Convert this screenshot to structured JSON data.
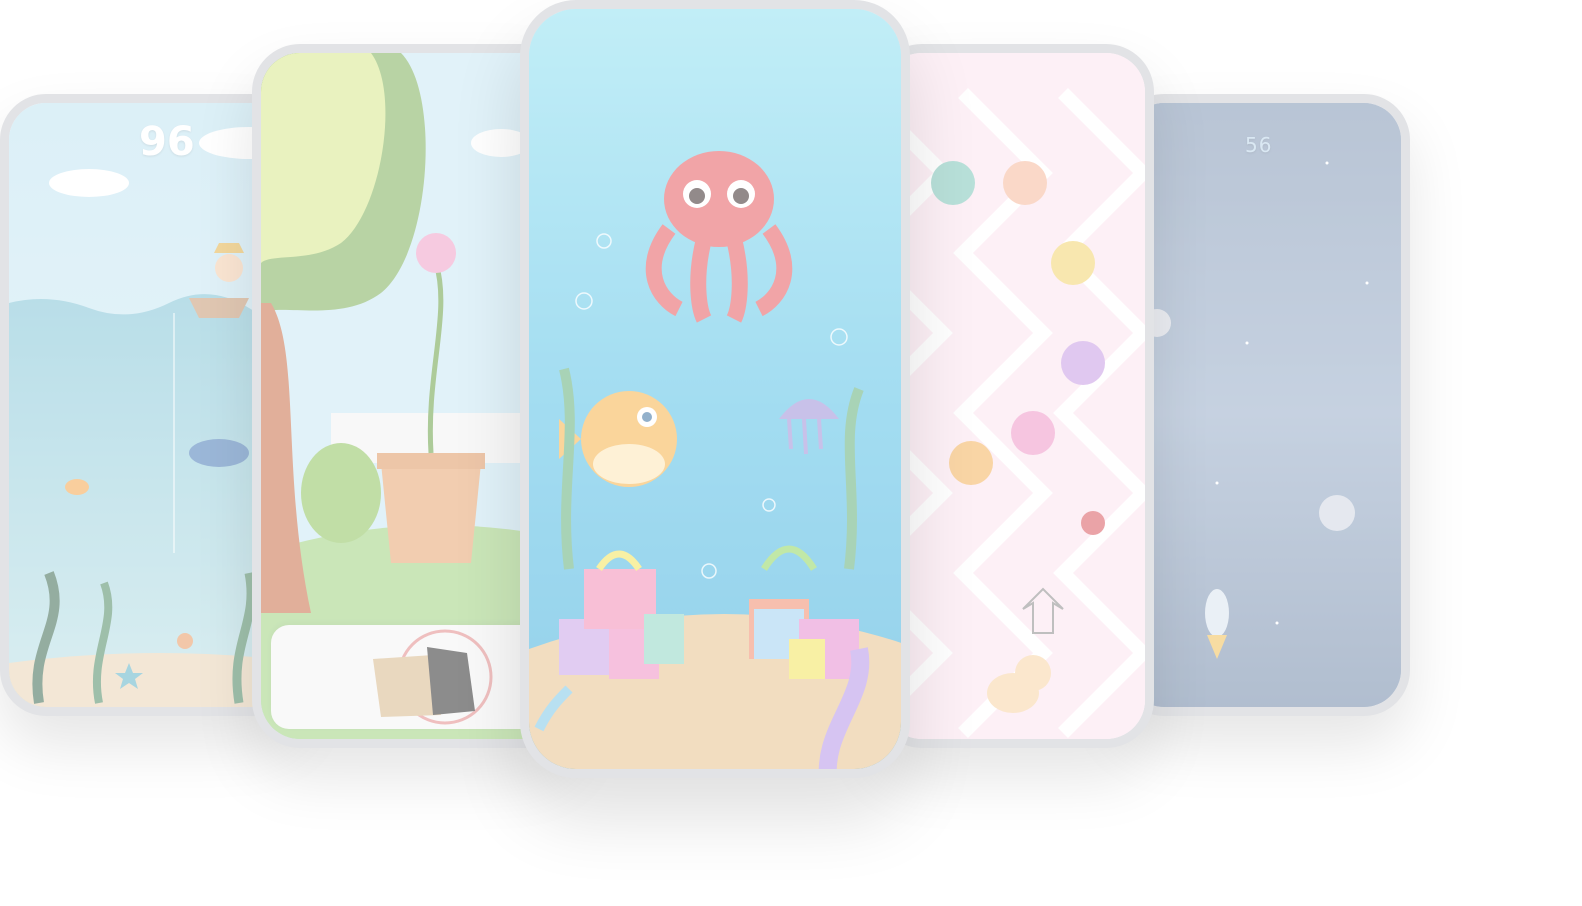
{
  "phones": [
    {
      "name": "fishing-game",
      "score": "96"
    },
    {
      "name": "flower-garden-game"
    },
    {
      "name": "underwater-gifts-game"
    },
    {
      "name": "candy-cat-game"
    },
    {
      "name": "space-rocket-game",
      "score": "56"
    }
  ],
  "colors": {
    "frame": "#e2e3e6",
    "sea": "#a8d8ea",
    "candy_pink": "#f7d6e6",
    "space": "#c9d6e6"
  }
}
